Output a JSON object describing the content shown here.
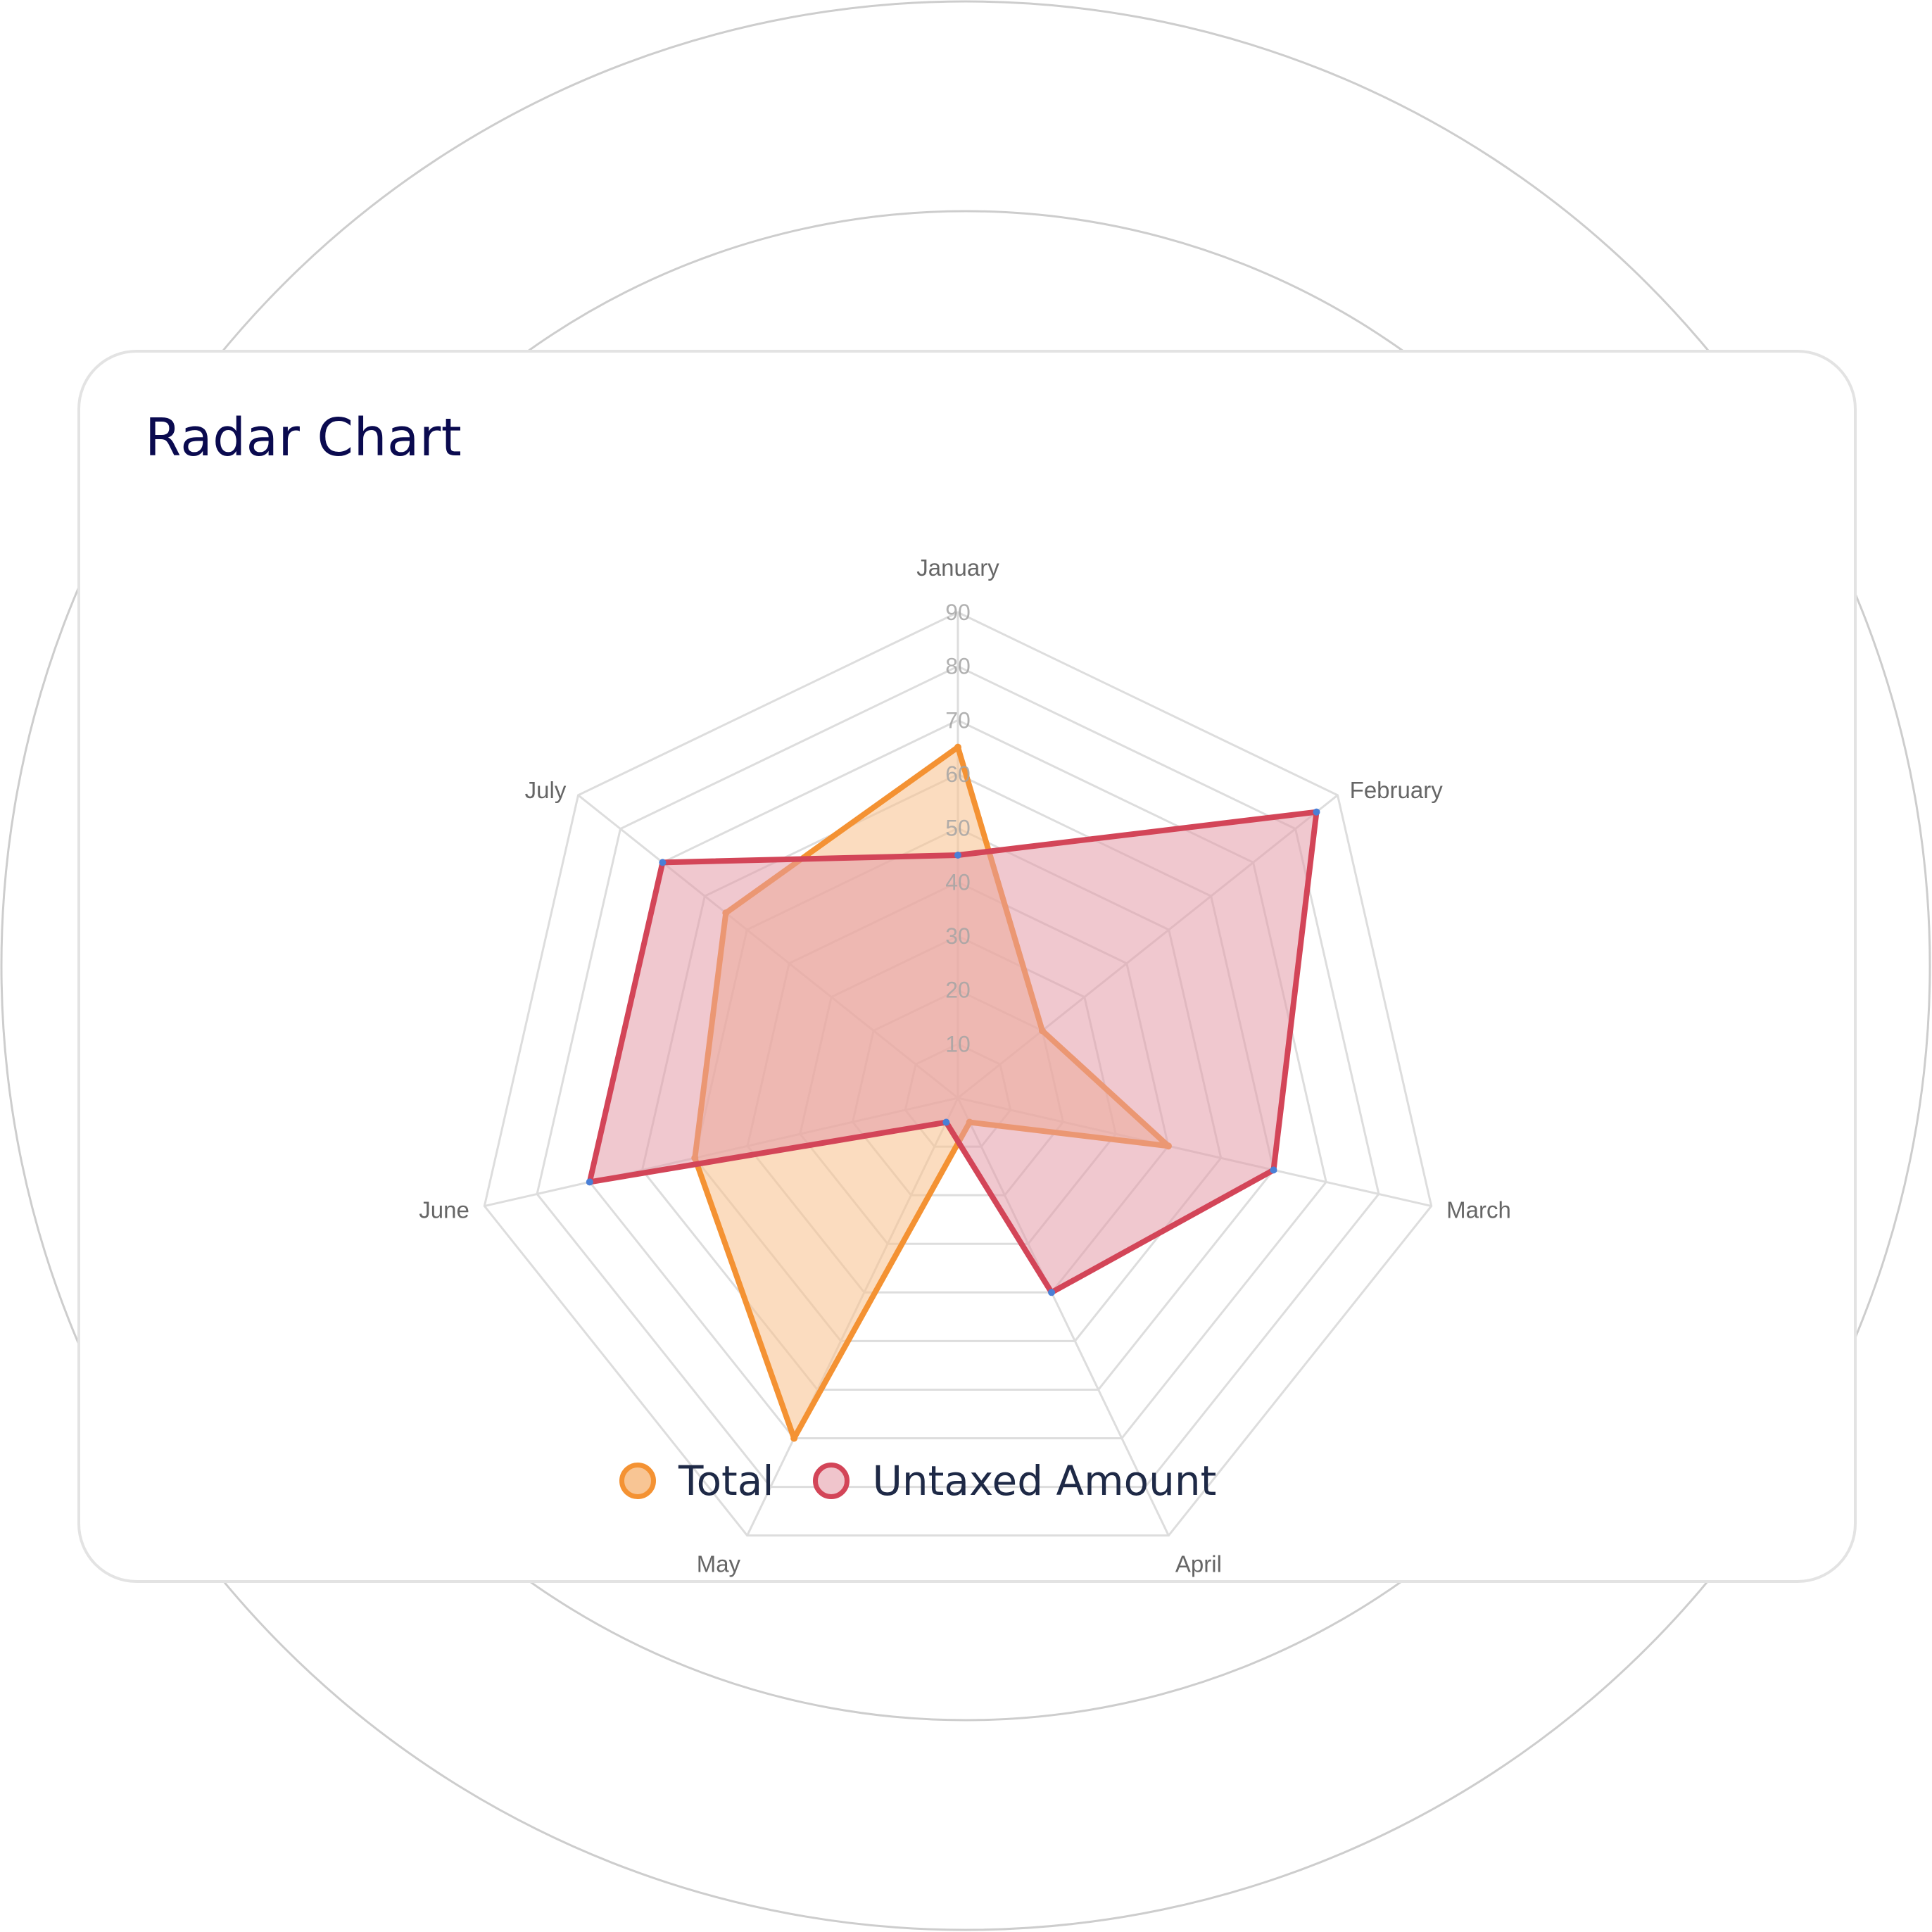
{
  "colors": {
    "total_stroke": "#f49233",
    "total_fill": "#f8c594",
    "untaxed_stroke": "#d34558",
    "untaxed_fill": "#e49aa8",
    "grid": "#dddddd",
    "axis_label": "#666666",
    "tick_label": "#a3a3a3",
    "point": "#4a7fd6"
  },
  "card": {
    "title": "Radar Chart"
  },
  "chart_data": {
    "type": "radar",
    "categories": [
      "January",
      "February",
      "March",
      "April",
      "May",
      "June",
      "July"
    ],
    "r_ticks": [
      10,
      20,
      30,
      40,
      50,
      60,
      70,
      80,
      90
    ],
    "rlim": [
      0,
      90
    ],
    "series": [
      {
        "name": "Total",
        "values": [
          65,
          20,
          40,
          5,
          70,
          50,
          55
        ]
      },
      {
        "name": "Untaxed Amount",
        "values": [
          45,
          85,
          60,
          40,
          5,
          70,
          70
        ]
      }
    ],
    "legend_position": "bottom"
  },
  "legend": {
    "items": [
      {
        "label": "Total"
      },
      {
        "label": "Untaxed Amount"
      }
    ]
  }
}
